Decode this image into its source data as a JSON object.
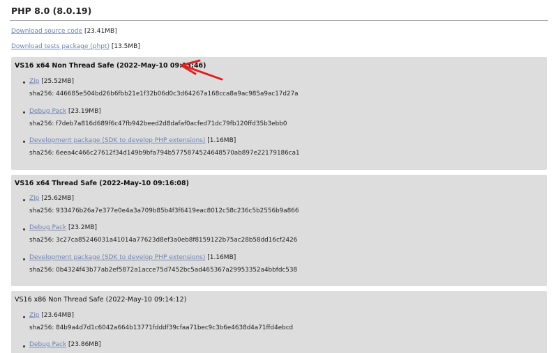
{
  "page": {
    "title": "PHP 8.0 (8.0.19)"
  },
  "downloads": {
    "source": {
      "label": "Download source code",
      "size": "[23.41MB]"
    },
    "tests": {
      "label": "Download tests package (phpt)",
      "size": "[13.5MB]"
    }
  },
  "builds": [
    {
      "title": "VS16 x64 Non Thread Safe (2022-May-10 09:13:46)",
      "files": [
        {
          "label": "Zip",
          "size": "[25.52MB]",
          "sha": "sha256: 446685e504bd26b6fbb21e1f32b06d0c3d64267a168cca8a9ac985a9ac17d27a"
        },
        {
          "label": "Debug Pack",
          "size": "[23.19MB]",
          "sha": "sha256: f7deb7a816d689f6c47fb942beed2d8dafaf0acfed71dc79fb120ffd35b3ebb0"
        },
        {
          "label": "Development package (SDK to develop PHP extensions)",
          "size": "[1.16MB]",
          "sha": "sha256: 6eea4c466c27612f34d149b9bfa794b5775874524648570ab897e22179186ca1"
        }
      ]
    },
    {
      "title": "VS16 x64 Thread Safe (2022-May-10 09:16:08)",
      "files": [
        {
          "label": "Zip",
          "size": "[25.62MB]",
          "sha": "sha256: 933476b26a7e377e0e4a3a709b85b4f3f6419eac8012c58c236c5b2556b9a866"
        },
        {
          "label": "Debug Pack",
          "size": "[23.2MB]",
          "sha": "sha256: 3c27ca85246031a41014a77623d8ef3a0eb8f8159122b75ac28b58dd16cf2426"
        },
        {
          "label": "Development package (SDK to develop PHP extensions)",
          "size": "[1.16MB]",
          "sha": "sha256: 0b4324f43b77ab2ef5872a1acce75d7452bc5ad465367a29953352a4bbfdc538"
        }
      ]
    },
    {
      "title": "VS16 x86 Non Thread Safe (2022-May-10 09:14:12)",
      "files": [
        {
          "label": "Zip",
          "size": "[23.64MB]",
          "sha": "sha256: 84b9a4d7d1c6042a664b13771fdddf39cfaa71bec9c3b6e4638d4a71ffd4ebcd"
        },
        {
          "label": "Debug Pack",
          "size": "[23.86MB]"
        }
      ]
    }
  ],
  "annotation": {
    "arrow_color": "#e02020"
  }
}
